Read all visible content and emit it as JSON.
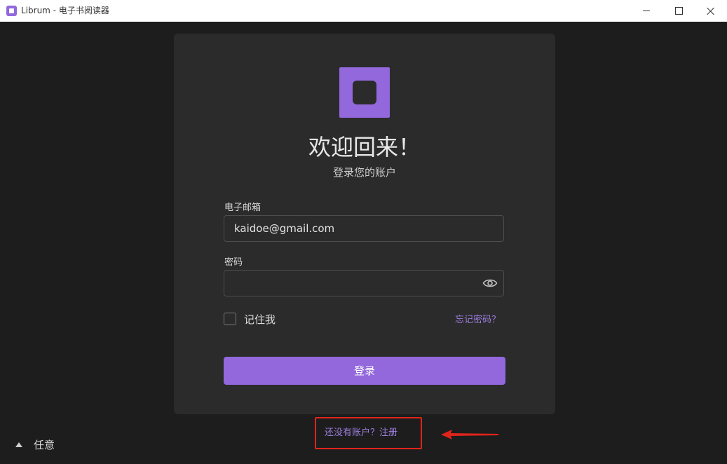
{
  "window": {
    "title": "Librum - 电子书阅读器"
  },
  "login": {
    "heading": "欢迎回来！",
    "subheading": "登录您的账户",
    "email_label": "电子邮箱",
    "email_value": "kaidoe@gmail.com",
    "password_label": "密码",
    "password_value": "",
    "remember_label": "记住我",
    "remember_checked": false,
    "forgot_link": "忘记密码？",
    "submit_label": "登录"
  },
  "signup": {
    "text": "还没有账户？注册"
  },
  "footer": {
    "mode_label": "任意"
  },
  "icons": {
    "app": "librum-logo-icon",
    "minimize": "minimize-icon",
    "maximize": "maximize-icon",
    "close": "close-icon",
    "password_visibility": "eye-icon",
    "collapse": "triangle-up-icon",
    "annotation": "arrow-left-icon"
  },
  "colors": {
    "accent": "#9368dd",
    "background": "#1d1d1d",
    "card": "#2b2b2b",
    "link": "#9c7ddc",
    "annotation": "#e0241a"
  }
}
